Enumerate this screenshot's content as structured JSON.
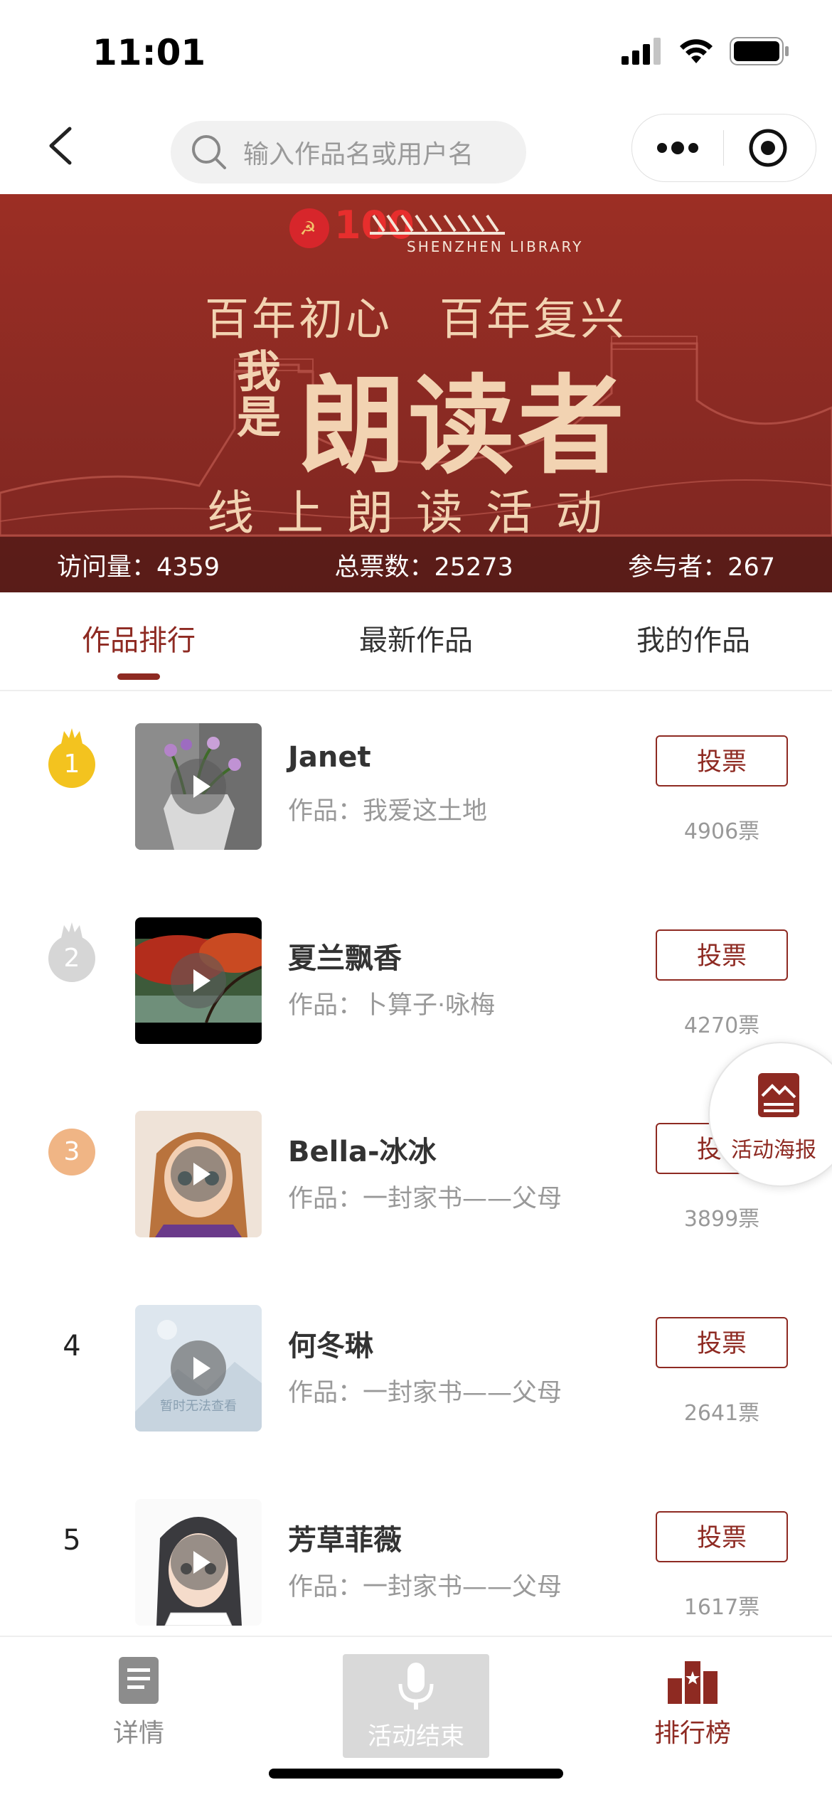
{
  "status": {
    "time": "11:01"
  },
  "search": {
    "placeholder": "输入作品名或用户名"
  },
  "banner": {
    "library_en": "SHENZHEN LIBRARY",
    "slogan": "百年初心　百年复兴",
    "wo_shi": "我是",
    "title": "朗读者",
    "subtitle": "线上朗读活动",
    "stats": {
      "visits": "访问量：4359",
      "votes": "总票数：25273",
      "participants": "参与者：267"
    }
  },
  "tabs": [
    {
      "label": "作品排行",
      "active": true
    },
    {
      "label": "最新作品",
      "active": false
    },
    {
      "label": "我的作品",
      "active": false
    }
  ],
  "list": [
    {
      "rank": "1",
      "name": "Janet",
      "work": "作品：我爱这土地",
      "vote_label": "投票",
      "votes": "4906票"
    },
    {
      "rank": "2",
      "name": "夏兰飘香",
      "work": "作品：卜算子·咏梅",
      "vote_label": "投票",
      "votes": "4270票"
    },
    {
      "rank": "3",
      "name": "Bella-冰冰",
      "work": "作品：一封家书——父母",
      "vote_label": "投票",
      "votes": "3899票"
    },
    {
      "rank": "4",
      "name": "何冬琳",
      "work": "作品：一封家书——父母",
      "vote_label": "投票",
      "votes": "2641票",
      "thumb_note": "暂时无法查看"
    },
    {
      "rank": "5",
      "name": "芳草菲薇",
      "work": "作品：一封家书——父母",
      "vote_label": "投票",
      "votes": "1617票"
    }
  ],
  "poster": {
    "label": "活动海报"
  },
  "bottom_nav": {
    "details": "详情",
    "record": "活动结束",
    "ranking": "排行榜"
  },
  "colors": {
    "accent": "#8e2a22",
    "banner": "#8a2a23"
  }
}
